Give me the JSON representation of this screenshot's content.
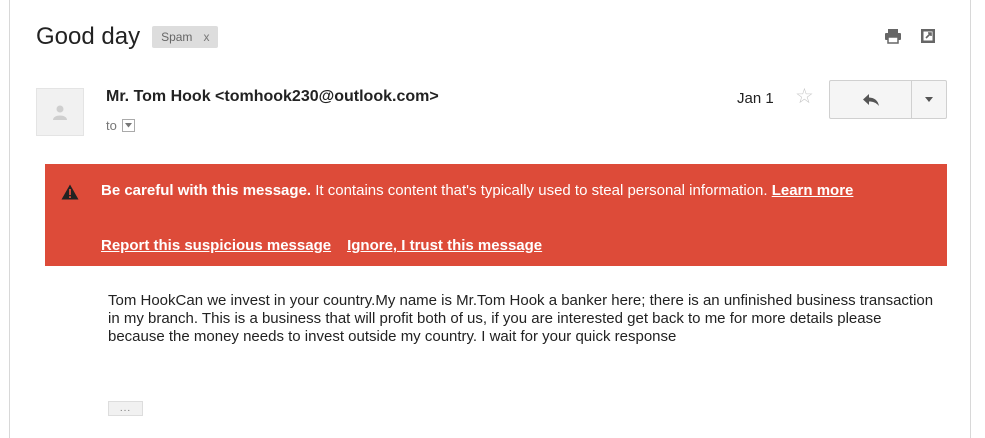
{
  "email": {
    "subject": "Good day",
    "label": {
      "name": "Spam",
      "remove": "x"
    },
    "sender": "Mr. Tom Hook <tomhook230@outlook.com>",
    "to_label": "to",
    "date": "Jan 1",
    "star": "☆"
  },
  "warning": {
    "bold_text": "Be careful with this message.",
    "text": " It contains content that's typically used to steal personal information. ",
    "learn_more": "Learn more",
    "report": "Report this suspicious message",
    "ignore": "Ignore, I trust this message",
    "color": "#dd4b39"
  },
  "body": {
    "text": "Tom HookCan we invest in your country.My name is Mr.Tom Hook a banker here; there is an unfinished business transaction in my branch. This is a business that will profit both of us, if you are interested get back to me for more details please because the money needs to invest outside my country. I wait for your quick response",
    "trimmed_toggle": "..."
  },
  "icons": [
    "print-icon",
    "new-window-icon",
    "avatar-icon",
    "star-icon",
    "reply-icon",
    "more-options-icon",
    "warning-icon"
  ]
}
